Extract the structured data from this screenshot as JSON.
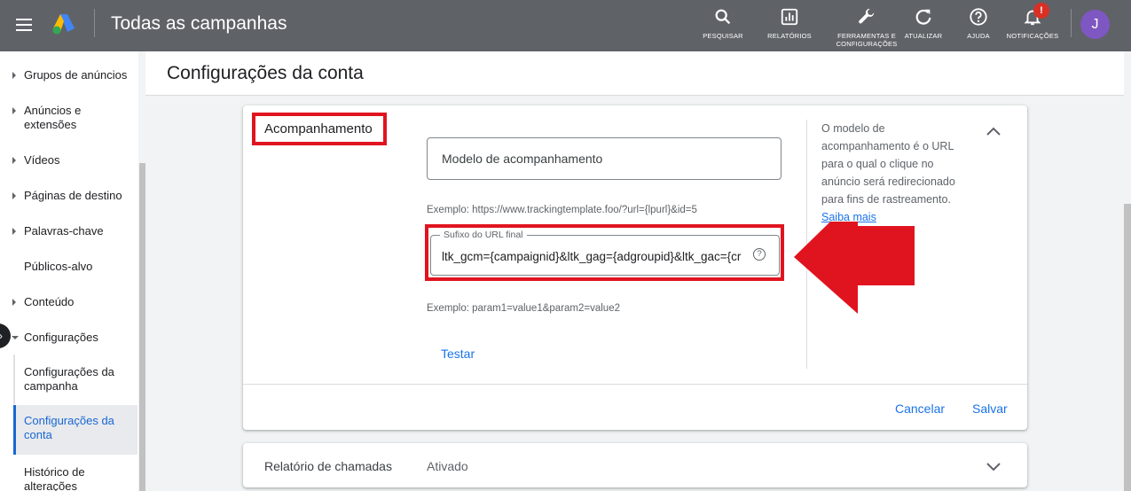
{
  "app": {
    "title": "Todas as campanhas",
    "user_initial": "J",
    "notification_badge": "!"
  },
  "toolbar": [
    {
      "label": "PESQUISAR",
      "icon": "search-icon"
    },
    {
      "label": "RELATÓRIOS",
      "icon": "reports-icon"
    },
    {
      "label": "FERRAMENTAS E CONFIGURAÇÕES",
      "icon": "wrench-icon"
    },
    {
      "label": "ATUALIZAR",
      "icon": "refresh-icon"
    },
    {
      "label": "AJUDA",
      "icon": "help-icon"
    },
    {
      "label": "NOTIFICAÇÕES",
      "icon": "bell-icon"
    }
  ],
  "sidebar": {
    "items": [
      {
        "label": "Grupos de anúncios",
        "caret": "right"
      },
      {
        "label": "Anúncios e extensões",
        "caret": "right"
      },
      {
        "label": "Vídeos",
        "caret": "right"
      },
      {
        "label": "Páginas de destino",
        "caret": "right"
      },
      {
        "label": "Palavras-chave",
        "caret": "right"
      },
      {
        "label": "Públicos-alvo",
        "caret": "none"
      },
      {
        "label": "Conteúdo",
        "caret": "right"
      },
      {
        "label": "Configurações",
        "caret": "down"
      }
    ],
    "subitems": [
      {
        "label": "Configurações da campanha",
        "active": false
      },
      {
        "label": "Configurações da conta",
        "active": true
      },
      {
        "label": "Histórico de alterações",
        "active": false
      }
    ]
  },
  "page": {
    "title": "Configurações da conta"
  },
  "tracking": {
    "section_title": "Acompanhamento",
    "template_placeholder": "Modelo de acompanhamento",
    "template_example": "Exemplo: https://www.trackingtemplate.foo/?url={lpurl}&id=5",
    "suffix_label": "Sufixo do URL final",
    "suffix_value": "ltk_gcm={campaignid}&ltk_gag={adgroupid}&ltk_gac={cr",
    "suffix_example": "Exemplo: param1=value1&param2=value2",
    "test_label": "Testar",
    "description": "O modelo de acompanhamento é o URL para o qual o clique no anúncio será redirecionado para fins de rastreamento.",
    "learn_more": "Saiba mais",
    "cancel_label": "Cancelar",
    "save_label": "Salvar"
  },
  "call_reporting": {
    "title": "Relatório de chamadas",
    "status": "Ativado"
  },
  "colors": {
    "topbar": "#5f6368",
    "accent": "#1a73e8",
    "highlight": "#e0141f",
    "avatar": "#7e57c2"
  }
}
